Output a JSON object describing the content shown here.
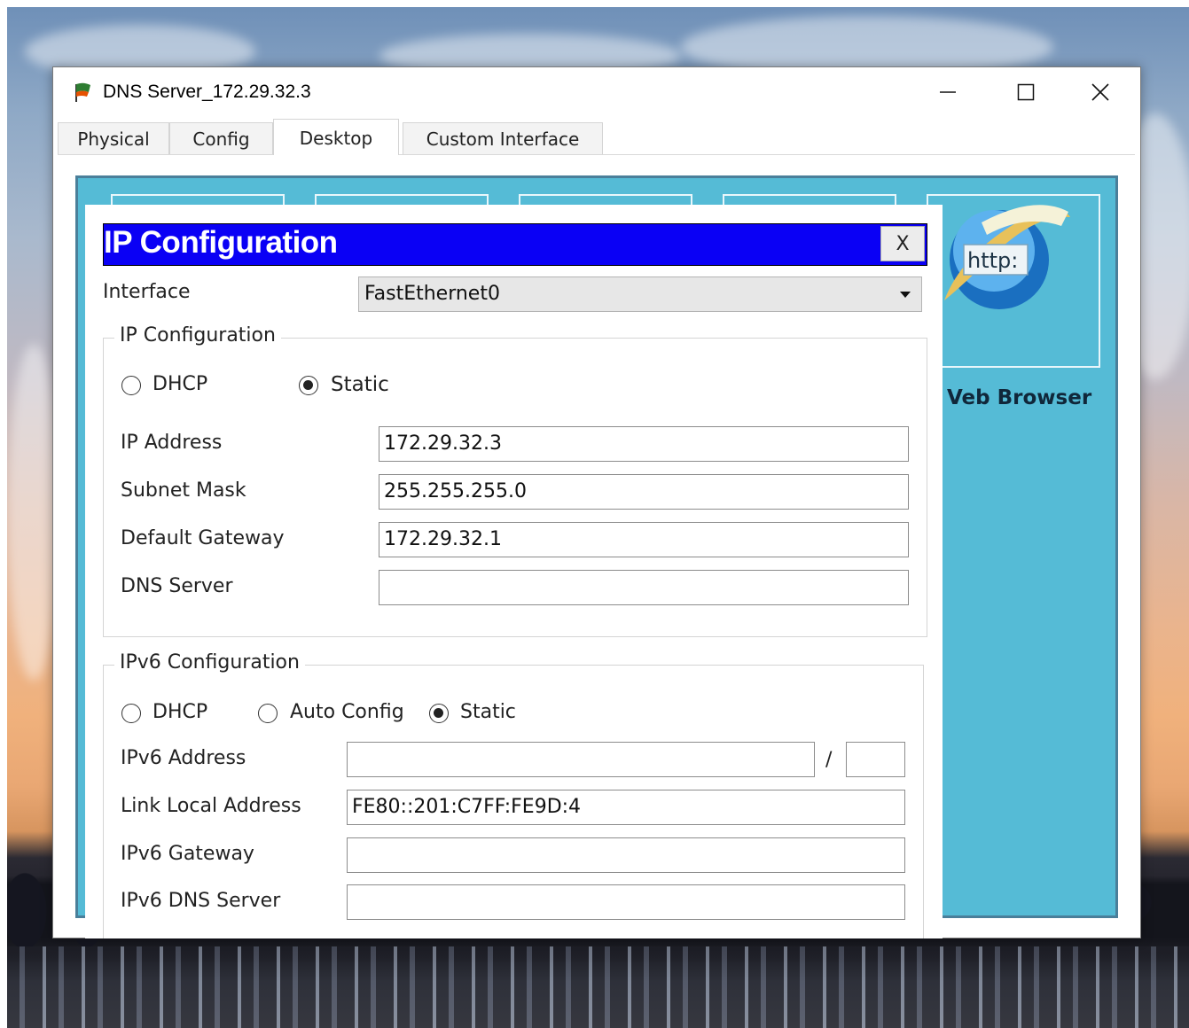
{
  "window": {
    "title": "DNS Server_172.29.32.3",
    "controls": {
      "minimize": "–",
      "maximize": "☐",
      "close": "✕"
    }
  },
  "tabs": [
    {
      "label": "Physical"
    },
    {
      "label": "Config"
    },
    {
      "label": "Desktop",
      "active": true
    },
    {
      "label": "Custom Interface"
    }
  ],
  "desktop": {
    "web_browser_label": "Veb Browser",
    "http_icon_text": "http:"
  },
  "ip_panel": {
    "title": "IP Configuration",
    "close_label": "X",
    "interface_label": "Interface",
    "interface_value": "FastEthernet0",
    "ipv4": {
      "legend": "IP Configuration",
      "dhcp_label": "DHCP",
      "static_label": "Static",
      "selected": "Static",
      "ip_address_label": "IP Address",
      "ip_address": "172.29.32.3",
      "subnet_mask_label": "Subnet Mask",
      "subnet_mask": "255.255.255.0",
      "default_gateway_label": "Default Gateway",
      "default_gateway": "172.29.32.1",
      "dns_server_label": "DNS Server",
      "dns_server": ""
    },
    "ipv6": {
      "legend": "IPv6 Configuration",
      "dhcp_label": "DHCP",
      "auto_config_label": "Auto Config",
      "static_label": "Static",
      "selected": "Static",
      "ipv6_address_label": "IPv6 Address",
      "ipv6_address": "",
      "prefix_separator": "/",
      "prefix_length": "",
      "link_local_label": "Link Local Address",
      "link_local_address": "FE80::201:C7FF:FE9D:4",
      "ipv6_gateway_label": "IPv6 Gateway",
      "ipv6_gateway": "",
      "ipv6_dns_label": "IPv6 DNS Server",
      "ipv6_dns": ""
    }
  },
  "colors": {
    "panel_header": "#0a00f5",
    "desktop_bg": "#55bbd6"
  }
}
